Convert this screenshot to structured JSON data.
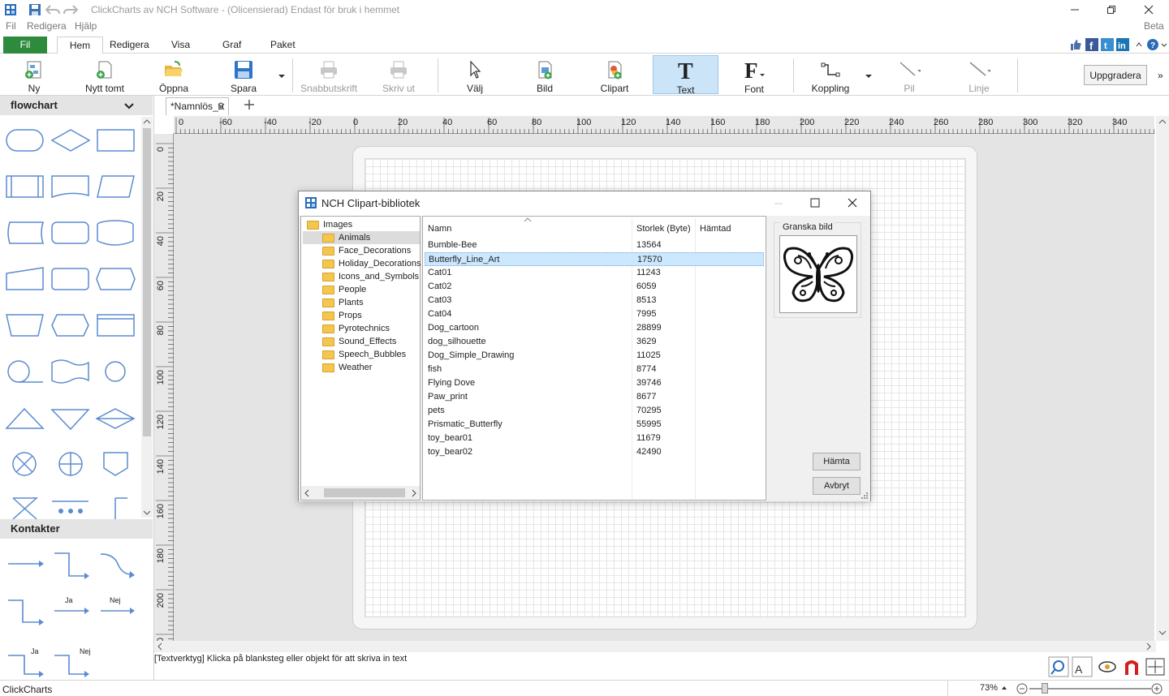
{
  "window": {
    "title": "ClickCharts av NCH Software - (Olicensierad) Endast för bruk i hemmet",
    "beta": "Beta"
  },
  "menu": [
    "Fil",
    "Redigera",
    "Hjälp"
  ],
  "ribbon_tabs": [
    "Fil",
    "Hem",
    "Redigera",
    "Visa",
    "Graf",
    "Paket"
  ],
  "toolbar": {
    "ny": "Ny",
    "nytt_tomt": "Nytt tomt",
    "oppna": "Öppna",
    "spara": "Spara",
    "snabbutskrift": "Snabbutskrift",
    "skriv_ut": "Skriv ut",
    "valj": "Välj",
    "bild": "Bild",
    "clipart": "Clipart",
    "text": "Text",
    "font": "Font",
    "koppling": "Koppling",
    "pil": "Pil",
    "linje": "Linje",
    "uppgradera": "Uppgradera"
  },
  "left_panel": {
    "shapes_header": "flowchart",
    "connectors_header": "Kontakter",
    "connector_labels": [
      "Ja",
      "Nej",
      "Ja",
      "Nej"
    ]
  },
  "document": {
    "tab_name": "*Namnlös_0"
  },
  "ruler": {
    "h_ticks": [
      "0",
      "-60",
      "-40",
      "-20",
      "0",
      "20",
      "40",
      "60",
      "80",
      "100",
      "120",
      "140",
      "160",
      "180",
      "200",
      "220",
      "240",
      "260",
      "280",
      "300",
      "320",
      "340"
    ],
    "v_ticks": [
      "0",
      "20",
      "40",
      "60",
      "80",
      "100",
      "120",
      "140",
      "160",
      "180",
      "200",
      "20"
    ]
  },
  "status": {
    "hint": "[Textverktyg] Klicka på blanksteg eller objekt för att skriva in text",
    "app_name": "ClickCharts",
    "zoom": "73%"
  },
  "dialog": {
    "title": "NCH Clipart-bibliotek",
    "tree_root": "Images",
    "tree_items": [
      "Animals",
      "Face_Decorations",
      "Holiday_Decorations",
      "Icons_and_Symbols",
      "People",
      "Plants",
      "Props",
      "Pyrotechnics",
      "Sound_Effects",
      "Speech_Bubbles",
      "Weather"
    ],
    "selected_folder": "Animals",
    "columns": [
      "Namn",
      "Storlek (Byte)",
      "Hämtad"
    ],
    "files": [
      {
        "name": "Bumble-Bee",
        "size": "13564"
      },
      {
        "name": "Butterfly_Line_Art",
        "size": "17570"
      },
      {
        "name": "Cat01",
        "size": "11243"
      },
      {
        "name": "Cat02",
        "size": "6059"
      },
      {
        "name": "Cat03",
        "size": "8513"
      },
      {
        "name": "Cat04",
        "size": "7995"
      },
      {
        "name": "Dog_cartoon",
        "size": "28899"
      },
      {
        "name": "dog_silhouette",
        "size": "3629"
      },
      {
        "name": "Dog_Simple_Drawing",
        "size": "11025"
      },
      {
        "name": "fish",
        "size": "8774"
      },
      {
        "name": "Flying Dove",
        "size": "39746"
      },
      {
        "name": "Paw_print",
        "size": "8677"
      },
      {
        "name": "pets",
        "size": "70295"
      },
      {
        "name": "Prismatic_Butterfly",
        "size": "55995"
      },
      {
        "name": "toy_bear01",
        "size": "11679"
      },
      {
        "name": "toy_bear02",
        "size": "42490"
      }
    ],
    "selected_file": "Butterfly_Line_Art",
    "preview_label": "Granska bild",
    "fetch_button": "Hämta",
    "cancel_button": "Avbryt"
  }
}
